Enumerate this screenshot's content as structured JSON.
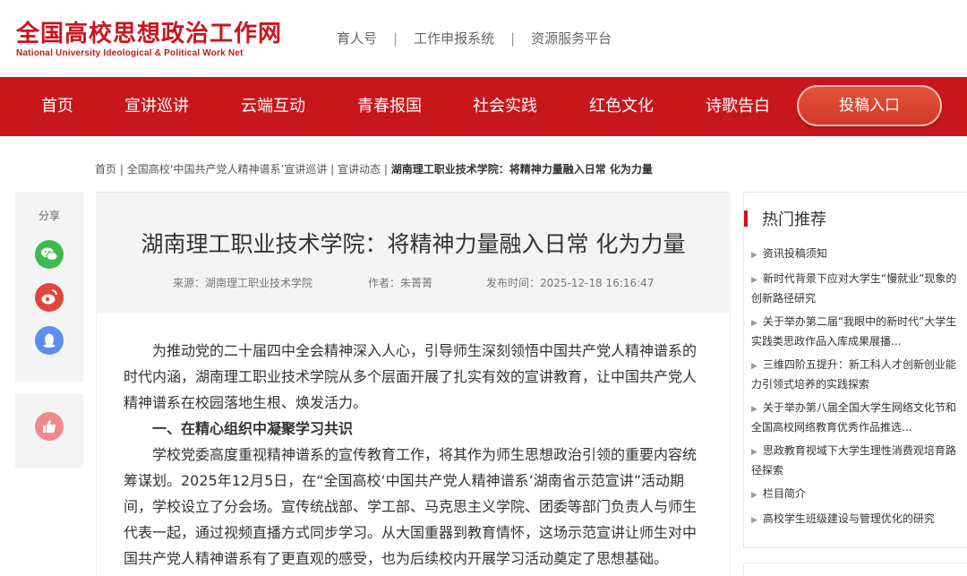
{
  "header": {
    "logo_cn": "全国高校思想政治工作网",
    "logo_en": "National University Ideological & Political Work Net",
    "top_links": [
      "育人号",
      "工作申报系统",
      "资源服务平台"
    ],
    "separator": "|"
  },
  "nav": {
    "items": [
      "首页",
      "宣讲巡讲",
      "云端互动",
      "青春报国",
      "社会实践",
      "红色文化",
      "诗歌告白"
    ],
    "submit_label": "投稿入口",
    "brand_color": "#c8161d"
  },
  "breadcrumb": {
    "items": [
      "首页",
      "全国高校‘中国共产党人精神谱系’宣讲巡讲",
      "宣讲动态",
      "湖南理工职业技术学院：将精神力量融入日常 化为力量"
    ],
    "separator": " | "
  },
  "share": {
    "label": "分享",
    "icons": [
      "wechat-icon",
      "weibo-icon",
      "qq-icon"
    ],
    "like_icon": "thumbs-up-icon"
  },
  "article": {
    "title": "湖南理工职业技术学院：将精神力量融入日常 化为力量",
    "source": "来源：湖南理工职业技术学院",
    "author": "作者：朱菁菁",
    "published": "发布时间：2025-12-18 16:16:47",
    "p1": "为推动党的二十届四中全会精神深入人心，引导师生深刻领悟中国共产党人精神谱系的时代内涵，湖南理工职业技术学院从多个层面开展了扎实有效的宣讲教育，让中国共产党人精神谱系在校园落地生根、焕发活力。",
    "h1": "一、在精心组织中凝聚学习共识",
    "p2": "学校党委高度重视精神谱系的宣传教育工作，将其作为师生思想政治引领的重要内容统筹谋划。2025年12月5日，在“全国高校‘中国共产党人精神谱系’湖南省示范宣讲”活动期间，学校设立了分会场。宣传统战部、学工部、马克思主义学院、团委等部门负责人与师生代表一起，通过视频直播方式同步学习。从大国重器到教育情怀，这场示范宣讲让师生对中国共产党人精神谱系有了更直观的感受，也为后续校内开展学习活动奠定了思想基础。"
  },
  "sidebar": {
    "title": "热门推荐",
    "items": [
      "资讯投稿须知",
      "新时代背景下应对大学生“慢就业”现象的创新路径研究",
      "关于举办第二届“我眼中的新时代”大学生实践类思政作品入库成果展播...",
      "三维四阶五提升：新工科人才创新创业能力引领式培养的实践探索",
      "关于举办第八届全国大学生网络文化节和全国高校网络教育优秀作品推选...",
      "思政教育视域下大学生理性消费观培育路径探索",
      "栏目简介",
      "高校学生班级建设与管理优化的研究"
    ]
  }
}
